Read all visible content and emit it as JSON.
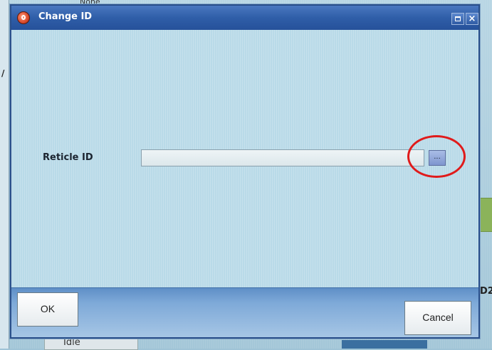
{
  "background": {
    "top_label": "None",
    "status_label": "Idle",
    "right_label": "D2"
  },
  "dialog": {
    "title": "Change ID",
    "field_label": "Reticle ID",
    "field_value": "",
    "browse_label": "...",
    "ok_label": "OK",
    "cancel_label": "Cancel",
    "close_glyph": "×"
  },
  "colors": {
    "titlebar": "#2f5ea8",
    "content_bg": "#b9dae8",
    "highlight": "#e01b1b"
  },
  "icons": [
    "app-icon",
    "maximize-icon",
    "close-icon"
  ]
}
